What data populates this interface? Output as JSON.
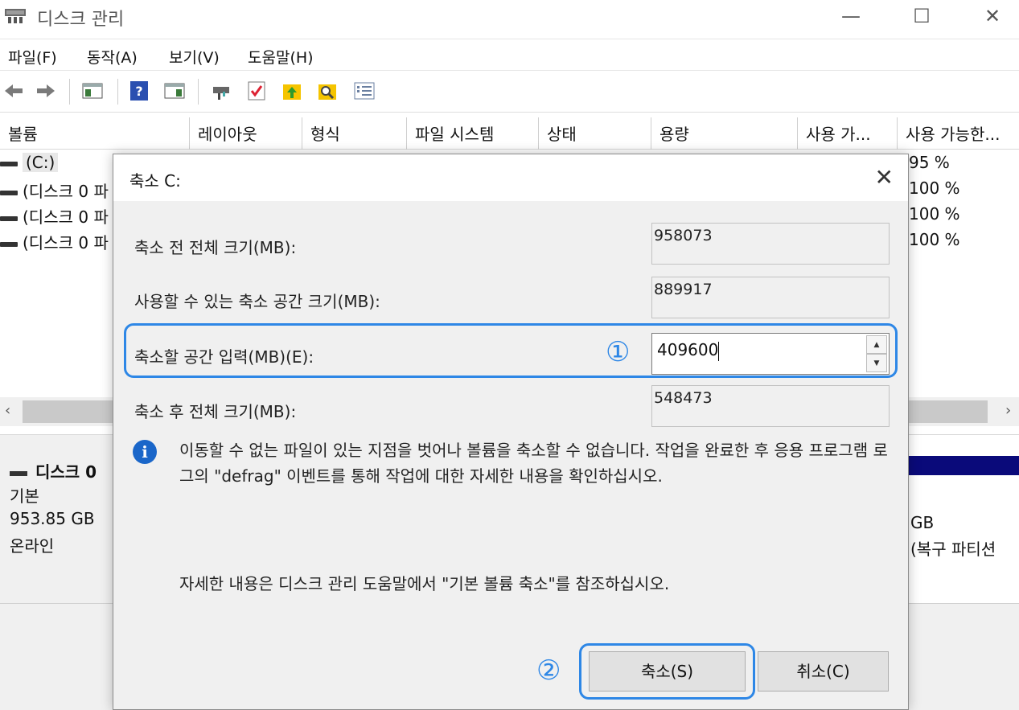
{
  "window": {
    "title": "디스크 관리",
    "minimize_glyph": "—",
    "maximize_glyph": "☐",
    "close_glyph": "✕"
  },
  "menu": [
    "파일(F)",
    "동작(A)",
    "보기(V)",
    "도움말(H)"
  ],
  "toolbar_icons": [
    "back-arrow-icon",
    "forward-arrow-icon",
    "console-tree-icon",
    "help-icon",
    "action-pane-icon",
    "connect-icon",
    "properties-check-icon",
    "up-folder-icon",
    "search-folder-icon",
    "list-view-icon"
  ],
  "volume_list": {
    "columns": [
      "볼륨",
      "레이아웃",
      "형식",
      "파일 시스템",
      "상태",
      "용량",
      "사용 가...",
      "사용 가능한..."
    ],
    "rows": [
      {
        "volume": "(C:)",
        "free_pct": "95 %"
      },
      {
        "volume": "(디스크 0 파",
        "free_pct": "100 %"
      },
      {
        "volume": "(디스크 0 파",
        "free_pct": "100 %"
      },
      {
        "volume": "(디스크 0 파",
        "free_pct": "100 %"
      }
    ]
  },
  "disk_panel": {
    "name": "디스크 0",
    "type": "기본",
    "size": "953.85 GB",
    "status": "온라인",
    "partition_size": "GB",
    "partition_label": "(복구 파티션"
  },
  "dialog": {
    "title": "축소 C:",
    "close_glyph": "✕",
    "total_before_label": "축소 전 전체 크기(MB):",
    "total_before_value": "958073",
    "available_label": "사용할 수 있는 축소 공간 크기(MB):",
    "available_value": "889917",
    "enter_label": "축소할 공간 입력(MB)(E):",
    "enter_value": "409600",
    "total_after_label": "축소 후 전체 크기(MB):",
    "total_after_value": "548473",
    "info_text": "이동할 수 없는 파일이 있는 지점을 벗어나 볼륨을 축소할 수 없습니다. 작업을 완료한 후 응용 프로그램 로그의 \"defrag\" 이벤트를 통해 작업에 대한 자세한 내용을 확인하십시오.",
    "ref_text": "자세한 내용은 디스크 관리 도움말에서 \"기본 볼륨 축소\"를 참조하십시오.",
    "shrink_button": "축소(S)",
    "cancel_button": "취소(C)",
    "step1_marker": "①",
    "step2_marker": "②"
  },
  "colors": {
    "highlight": "#2e87e6",
    "info_icon": "#1a66c9",
    "partition_bar": "#0a0a7a"
  }
}
